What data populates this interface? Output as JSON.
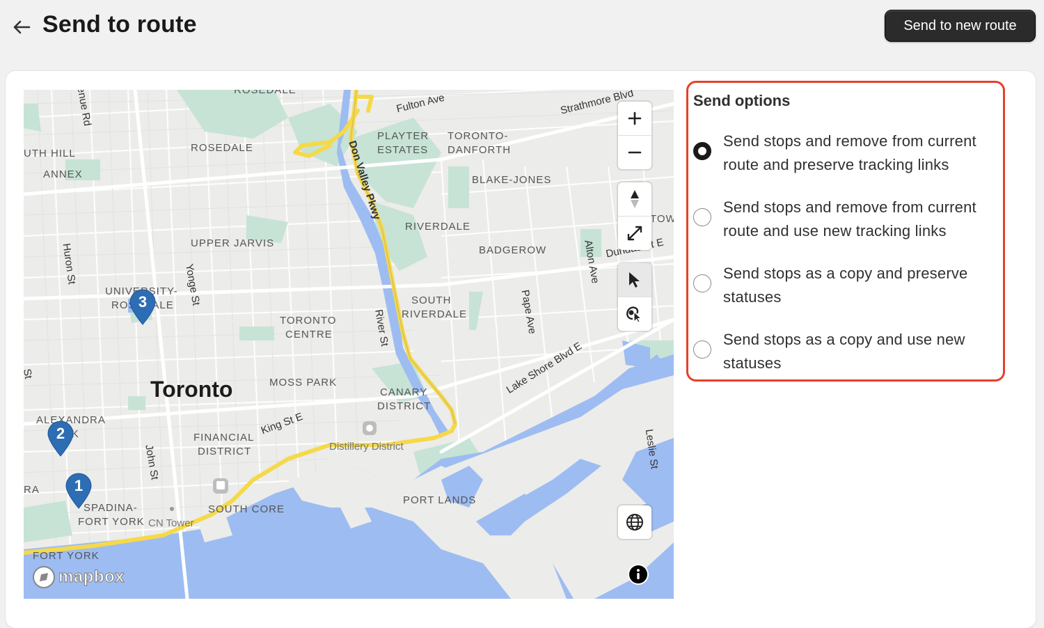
{
  "header": {
    "title": "Send to route",
    "new_route_label": "Send to new route"
  },
  "map": {
    "labels": {
      "rosedale": "ROSEDALE",
      "player_estates_1": "PLAYTER",
      "player_estates_2": "ESTATES",
      "toronto_danforth_1": "TORONTO-",
      "toronto_danforth_2": "DANFORTH",
      "blake_jones": "BLAKE-JONES",
      "riverdale": "RIVERDALE",
      "badgerow": "BADGEROW",
      "upper_jarvis": "UPPER JARVIS",
      "south_riverdale_1": "SOUTH",
      "south_riverdale_2": "RIVERDALE",
      "toronto_centre_1": "TORONTO",
      "toronto_centre_2": "CENTRE",
      "university_1": "UNIVERSITY-",
      "university_2": "ROSEDALE",
      "moss_park": "MOSS PARK",
      "canary_1": "CANARY",
      "canary_2": "DISTRICT",
      "financial_1": "FINANCIAL",
      "financial_2": "DISTRICT",
      "alexandra_1": "ALEXANDRA",
      "alexandra_2": "PARK",
      "spadina_1": "SPADINA-",
      "spadina_2": "FORT YORK",
      "south_core": "SOUTH CORE",
      "port_lands": "PORT LANDS",
      "fort_york": "FORT YORK",
      "annex": "ANNEX",
      "south_hill": "UTH HILL",
      "ra": "RA",
      "rosedale_top": "ROSEDALE",
      "town": "TOWN",
      "city": "Toronto",
      "fulton": "Fulton Ave",
      "strathmore": "Strathmore Blvd",
      "don_valley": "Don Valley Pkwy",
      "river_st": "River St",
      "pape": "Pape Ave",
      "alton": "Alton Ave",
      "dundas": "Dundas St E",
      "yonge": "Yonge St",
      "huron": "Huron St",
      "john": "John St",
      "king": "King St E",
      "lake_shore": "Lake Shore Blvd E",
      "leslie": "Leslie St",
      "avenue_rd": "enue Rd",
      "st_edge": "St",
      "distillery": "Distillery District",
      "cn_tower": "CN Tower"
    },
    "pins": [
      {
        "number": "1"
      },
      {
        "number": "2"
      },
      {
        "number": "3"
      }
    ],
    "attribution": "mapbox",
    "controls": {
      "zoom_in": "zoom-in",
      "zoom_out": "zoom-out",
      "compass": "compass",
      "fullscreen": "fullscreen",
      "select": "select-pointer",
      "lasso": "lasso-select",
      "globe": "globe",
      "info": "info"
    }
  },
  "send_options": {
    "title": "Send options",
    "selected_index": 0,
    "options": [
      {
        "label": "Send stops and remove from current route and preserve tracking links"
      },
      {
        "label": "Send stops and remove from current route and use new tracking links"
      },
      {
        "label": "Send stops as a copy and preserve statuses"
      },
      {
        "label": "Send stops as a copy and use new statuses"
      }
    ]
  },
  "colors": {
    "highlight_border": "#e5402a",
    "pin": "#2d6db3",
    "highway": "#f5d94a",
    "water": "#9dbcf2",
    "park": "#c6e3d6"
  }
}
